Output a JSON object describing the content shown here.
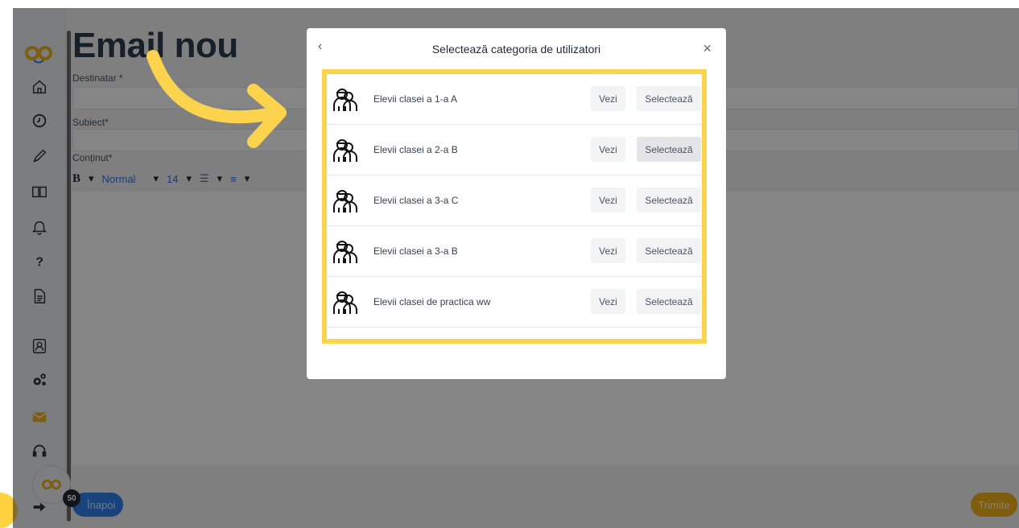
{
  "page": {
    "title": "Email nou",
    "recipient_label": "Destinatar *",
    "subject_label": "Subiect*",
    "content_label": "Conținut*",
    "toolbar": {
      "bold": "B",
      "format": "Normal",
      "size": "14"
    },
    "back_label": "Înapoi",
    "send_label": "Trimite",
    "notification_count": "50"
  },
  "sidebar": {
    "icons": [
      "home-icon",
      "clock-icon",
      "pencil-icon",
      "book-icon",
      "bell-icon",
      "help-icon",
      "document-icon",
      "contacts-icon",
      "settings-icon",
      "mail-icon",
      "headset-icon",
      "logout-icon"
    ],
    "active": "mail-icon",
    "accent": "#f2b21b"
  },
  "modal": {
    "title": "Selectează categoria de utilizatori",
    "back_glyph": "‹",
    "close_glyph": "×",
    "items": [
      {
        "label": "Elevii clasei a 1-a A",
        "view": "Vezi",
        "select": "Selectează"
      },
      {
        "label": "Elevii clasei a 2-a B",
        "view": "Vezi",
        "select": "Selectează"
      },
      {
        "label": "Elevii clasei a 3-a C",
        "view": "Vezi",
        "select": "Selectează"
      },
      {
        "label": "Elevii clasei a 3-a B",
        "view": "Vezi",
        "select": "Selectează"
      },
      {
        "label": "Elevii clasei de practica ww",
        "view": "Vezi",
        "select": "Selectează"
      }
    ],
    "highlight_color": "#fcd34d"
  }
}
